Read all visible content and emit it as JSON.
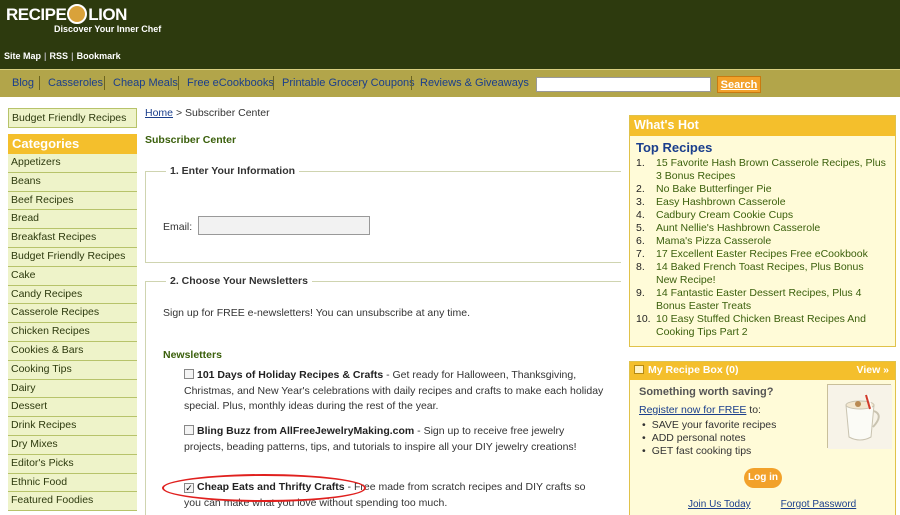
{
  "header": {
    "logo_part1": "RECIPE",
    "logo_part2": "LION",
    "tagline": "Discover Your Inner Chef",
    "links": [
      "Site Map",
      "RSS",
      "Bookmark"
    ]
  },
  "nav": {
    "items": [
      "Blog",
      "Casseroles",
      "Cheap Meals",
      "Free eCookbooks",
      "Printable Grocery Coupons",
      "Reviews & Giveaways"
    ],
    "search_value": "",
    "search_button": "Search"
  },
  "left": {
    "budget_link": "Budget Friendly Recipes",
    "categories_title": "Categories",
    "categories": [
      "Appetizers",
      "Beans",
      "Beef Recipes",
      "Bread",
      "Breakfast Recipes",
      "Budget Friendly Recipes",
      "Cake",
      "Candy Recipes",
      "Casserole Recipes",
      "Chicken Recipes",
      "Cookies & Bars",
      "Cooking Tips",
      "Dairy",
      "Dessert",
      "Drink Recipes",
      "Dry Mixes",
      "Editor's Picks",
      "Ethnic Food",
      "Featured Foodies"
    ]
  },
  "main": {
    "breadcrumb_home": "Home",
    "breadcrumb_sep": ">",
    "breadcrumb_current": "Subscriber Center",
    "page_title": "Subscriber Center",
    "section1_legend": "1. Enter Your Information",
    "email_label": "Email:",
    "email_value": "",
    "section2_legend": "2. Choose Your Newsletters",
    "signup_text": "Sign up for FREE e-newsletters! You can unsubscribe at any time.",
    "newsletters_heading": "Newsletters",
    "newsletters": [
      {
        "name": "101 Days of Holiday Recipes & Crafts",
        "desc": " - Get ready for Halloween, Thanksgiving, Christmas, and New Year's celebrations with daily recipes and crafts to make each holiday special. Plus, monthly ideas during the rest of the year.",
        "checked": ""
      },
      {
        "name": "Bling Buzz from AllFreeJewelryMaking.com",
        "desc": " - Sign up to receive free jewelry projects, beading patterns, tips, and tutorials to inspire all your DIY jewelry creations!",
        "checked": ""
      },
      {
        "name": "Cheap Eats and Thrifty Crafts",
        "desc": " - Free made from scratch recipes and DIY crafts so you can make what you love without spending too much.",
        "checked": "✓"
      }
    ]
  },
  "right": {
    "whats_hot": "What's Hot",
    "top_recipes": "Top Recipes",
    "recipes": [
      {
        "num": "1.",
        "text": "15 Favorite Hash Brown Casserole Recipes, Plus 3 Bonus Recipes"
      },
      {
        "num": "2.",
        "text": "No Bake Butterfinger Pie"
      },
      {
        "num": "3.",
        "text": "Easy Hashbrown Casserole"
      },
      {
        "num": "4.",
        "text": "Cadbury Cream Cookie Cups"
      },
      {
        "num": "5.",
        "text": "Aunt Nellie's Hashbrown Casserole"
      },
      {
        "num": "6.",
        "text": "Mama's Pizza Casserole"
      },
      {
        "num": "7.",
        "text": "17 Excellent Easter Recipes Free eCookbook"
      },
      {
        "num": "8.",
        "text": "14 Baked French Toast Recipes, Plus Bonus New Recipe!"
      },
      {
        "num": "9.",
        "text": "14 Fantastic Easter Dessert Recipes, Plus 4 Bonus Easter Treats"
      },
      {
        "num": "10.",
        "text": "10 Easy Stuffed Chicken Breast Recipes And Cooking Tips Part 2"
      }
    ],
    "recipe_box_title": "My Recipe Box (0)",
    "view_link": "View »",
    "worth_saving": "Something worth saving?",
    "register_link": "Register now for FREE",
    "register_suffix": " to:",
    "benefits": [
      "SAVE your favorite recipes",
      "ADD personal notes",
      "GET fast cooking tips"
    ],
    "login_button": "Log in",
    "join_link": "Join Us Today",
    "forgot_link": "Forgot Password"
  },
  "colors": {
    "header_bg": "#2d3a0e",
    "nav_bg": "#b2a54a",
    "accent_orange": "#f4bf2c",
    "link_blue": "#1a3e8c",
    "green_text": "#3a5f0b",
    "highlight_circle": "#e0201e"
  }
}
